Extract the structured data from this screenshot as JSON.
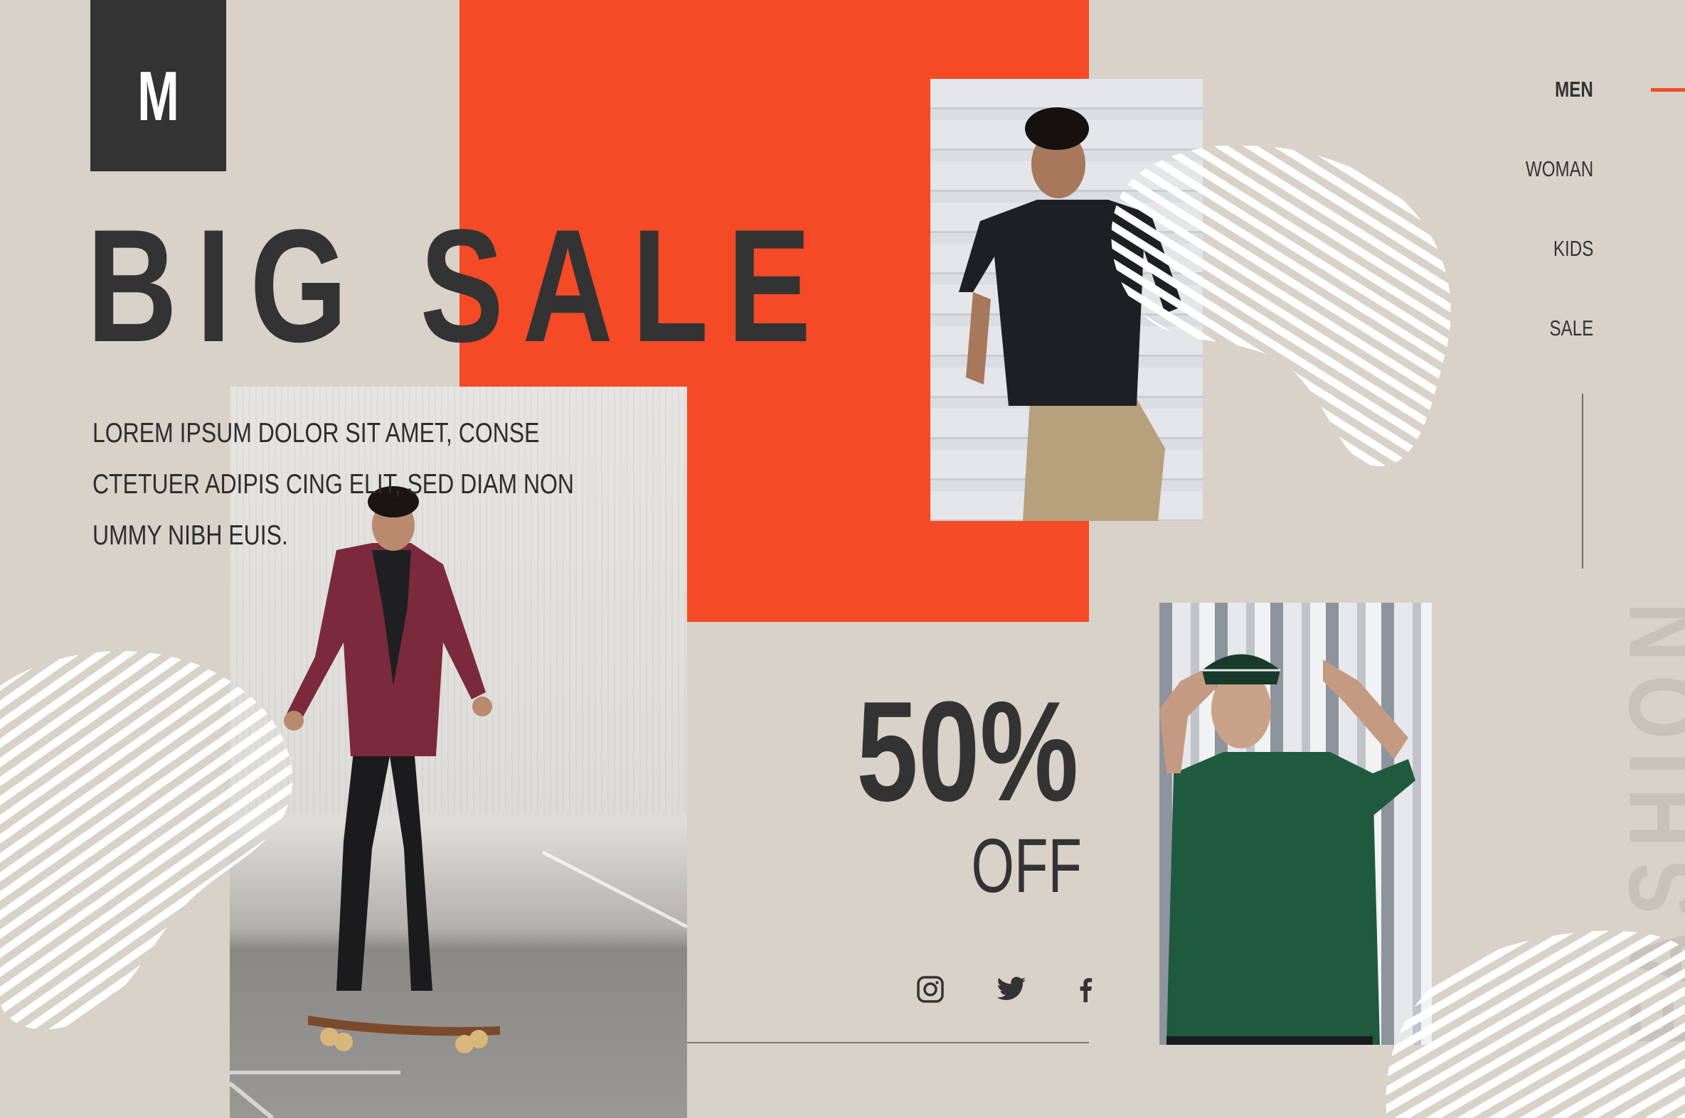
{
  "brand": {
    "logo_letter": "M"
  },
  "hero": {
    "headline": "BIG SALE"
  },
  "body_copy": {
    "lines": [
      "LOREM IPSUM DOLOR SIT AMET, CONSE",
      "CTETUER ADIPIS CING ELIT, SED DIAM NON",
      "UMMY NIBH EUIS."
    ]
  },
  "discount": {
    "percent": "50%",
    "suffix": "OFF"
  },
  "nav": {
    "items": [
      {
        "label": "MEN",
        "active": true
      },
      {
        "label": "WOMAN",
        "active": false
      },
      {
        "label": "KIDS",
        "active": false
      },
      {
        "label": "SALE",
        "active": false
      }
    ]
  },
  "vertical_text": "FASHION",
  "social": {
    "icons": [
      "instagram-icon",
      "twitter-icon",
      "facebook-icon"
    ]
  },
  "colors": {
    "background": "#d9d2c9",
    "accent": "#f44a25",
    "dark": "#333333",
    "wave": "#ffffff"
  }
}
